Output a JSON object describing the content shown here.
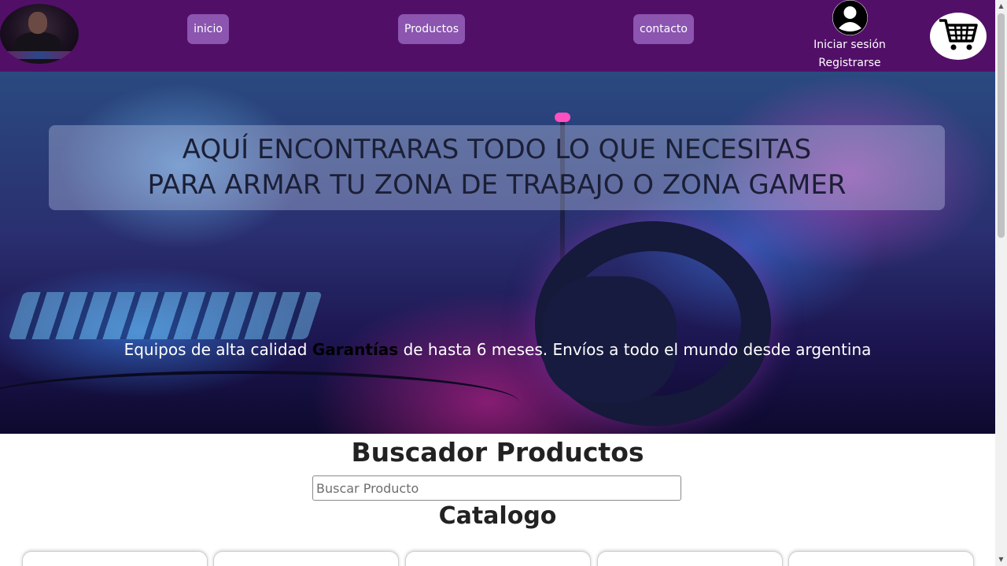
{
  "header": {
    "nav": {
      "inicio": "inicio",
      "productos": "Productos",
      "contacto": "contacto"
    },
    "auth": {
      "login": "Iniciar sesión",
      "register": "Registrarse"
    },
    "user_icon": "user-icon",
    "cart_icon": "cart-icon",
    "bg_color": "#520f68",
    "nav_color": "#8b55b0"
  },
  "hero": {
    "title_line1": "AQUÍ ENCONTRARAS TODO LO QUE NECESITAS",
    "title_line2": "PARA ARMAR TU ZONA DE TRABAJO O ZONA GAMER",
    "sub_part1": "Equipos de alta calidad",
    "sub_bold": "Garantías",
    "sub_part2": "de hasta 6 meses. Envíos a todo el mundo desde argentina"
  },
  "search": {
    "title": "Buscador Productos",
    "placeholder": "Buscar Producto",
    "value": ""
  },
  "catalog": {
    "title": "Catalogo",
    "cards": [
      {},
      {},
      {},
      {},
      {}
    ]
  }
}
